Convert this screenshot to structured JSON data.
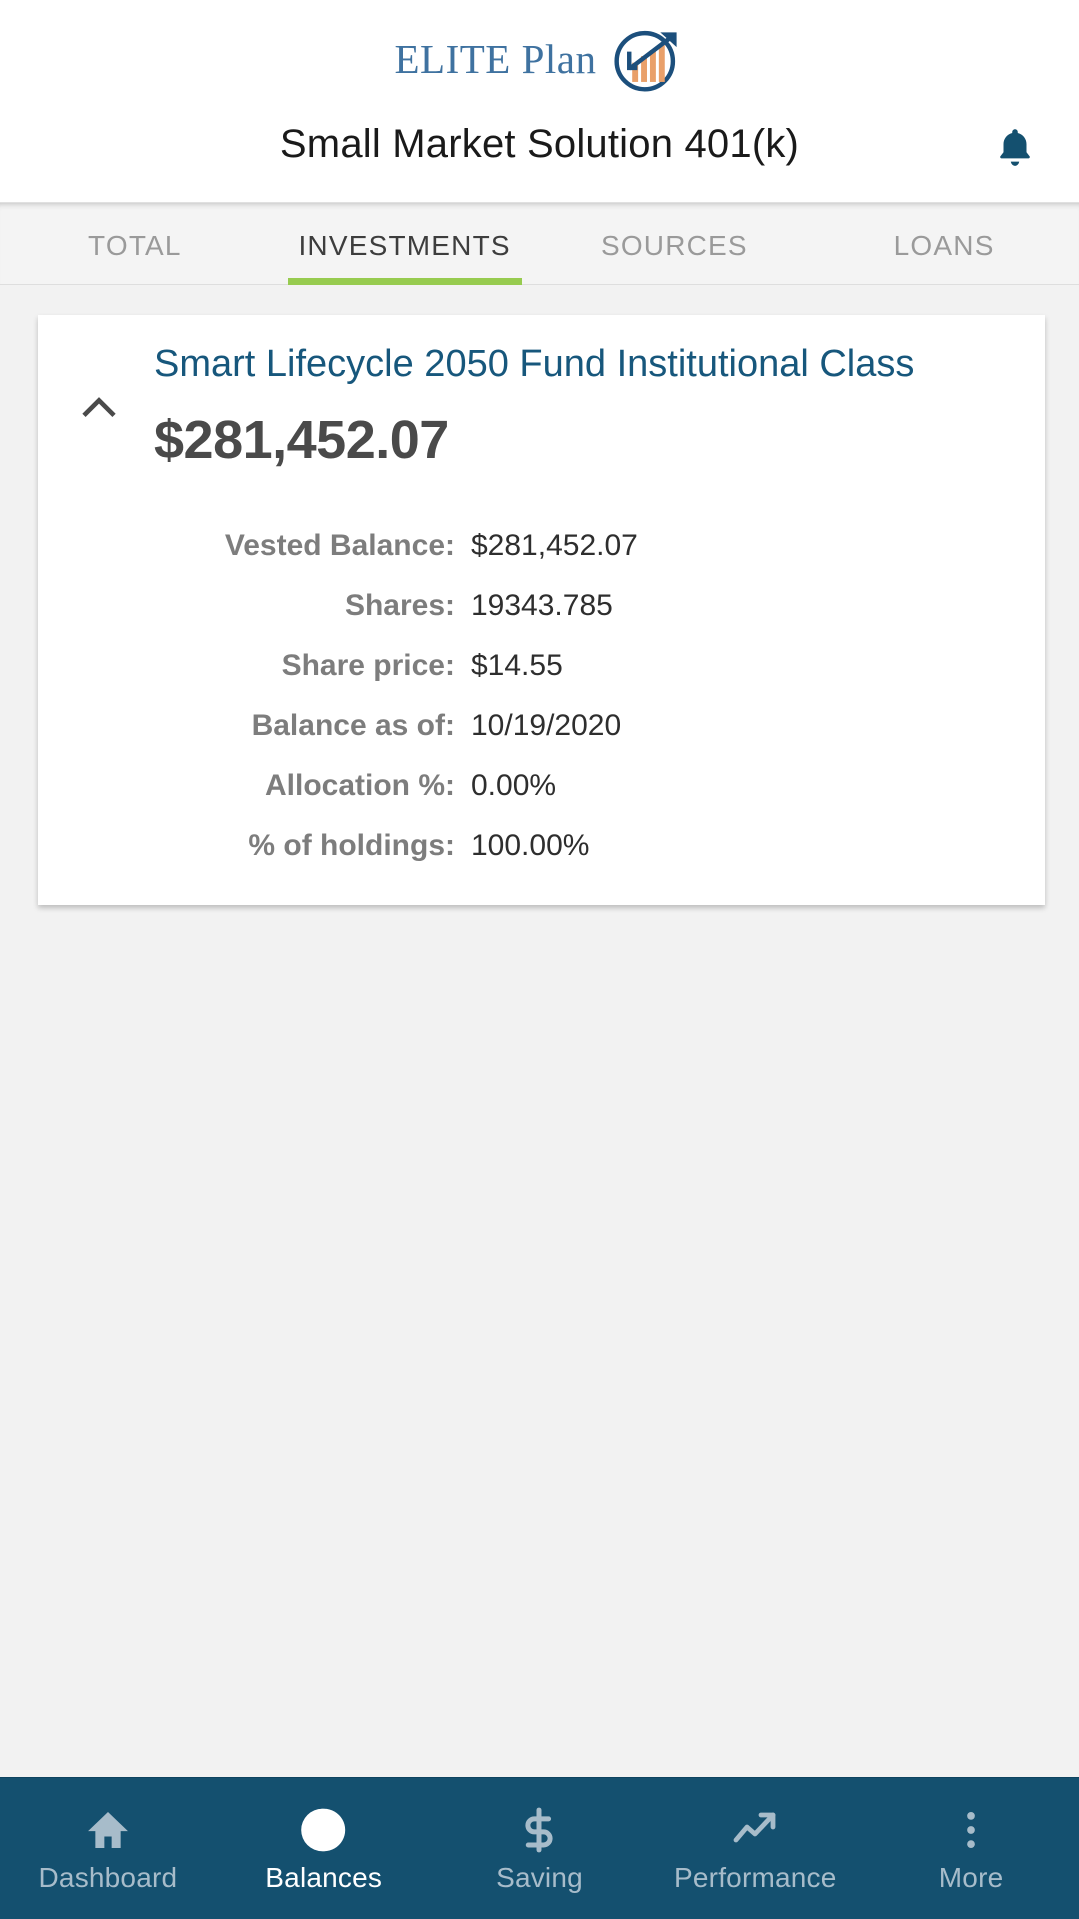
{
  "header": {
    "logo_text": "ELITE Plan",
    "logo_icon": "growth-chart-circle-logo",
    "title": "Small Market Solution 401(k)",
    "bell_icon": "notification-bell-icon"
  },
  "tabs": [
    {
      "label": "TOTAL",
      "active": false
    },
    {
      "label": "INVESTMENTS",
      "active": true
    },
    {
      "label": "SOURCES",
      "active": false
    },
    {
      "label": "LOANS",
      "active": false
    }
  ],
  "fund_card": {
    "collapse_icon": "chevron-up-icon",
    "name": "Smart Lifecycle 2050 Fund Institutional Class",
    "amount": "$281,452.07",
    "details": [
      {
        "label": "Vested Balance:",
        "value": "$281,452.07"
      },
      {
        "label": "Shares:",
        "value": "19343.785"
      },
      {
        "label": "Share price:",
        "value": "$14.55"
      },
      {
        "label": "Balance as of:",
        "value": "10/19/2020"
      },
      {
        "label": "Allocation %:",
        "value": "0.00%"
      },
      {
        "label": "% of holdings:",
        "value": "100.00%"
      }
    ]
  },
  "bottom_nav": [
    {
      "label": "Dashboard",
      "icon": "home-icon",
      "active": false
    },
    {
      "label": "Balances",
      "icon": "pie-chart-icon",
      "active": true
    },
    {
      "label": "Saving",
      "icon": "dollar-sign-icon",
      "active": false
    },
    {
      "label": "Performance",
      "icon": "trending-up-icon",
      "active": false
    },
    {
      "label": "More",
      "icon": "more-vertical-icon",
      "active": false
    }
  ],
  "colors": {
    "brand_blue": "#14506f",
    "logo_blue": "#3f72a0",
    "logo_orange": "#e9a06a",
    "accent_green": "#97cb4f",
    "fund_link_blue": "#17577c",
    "page_bg": "#f2f2f2"
  }
}
